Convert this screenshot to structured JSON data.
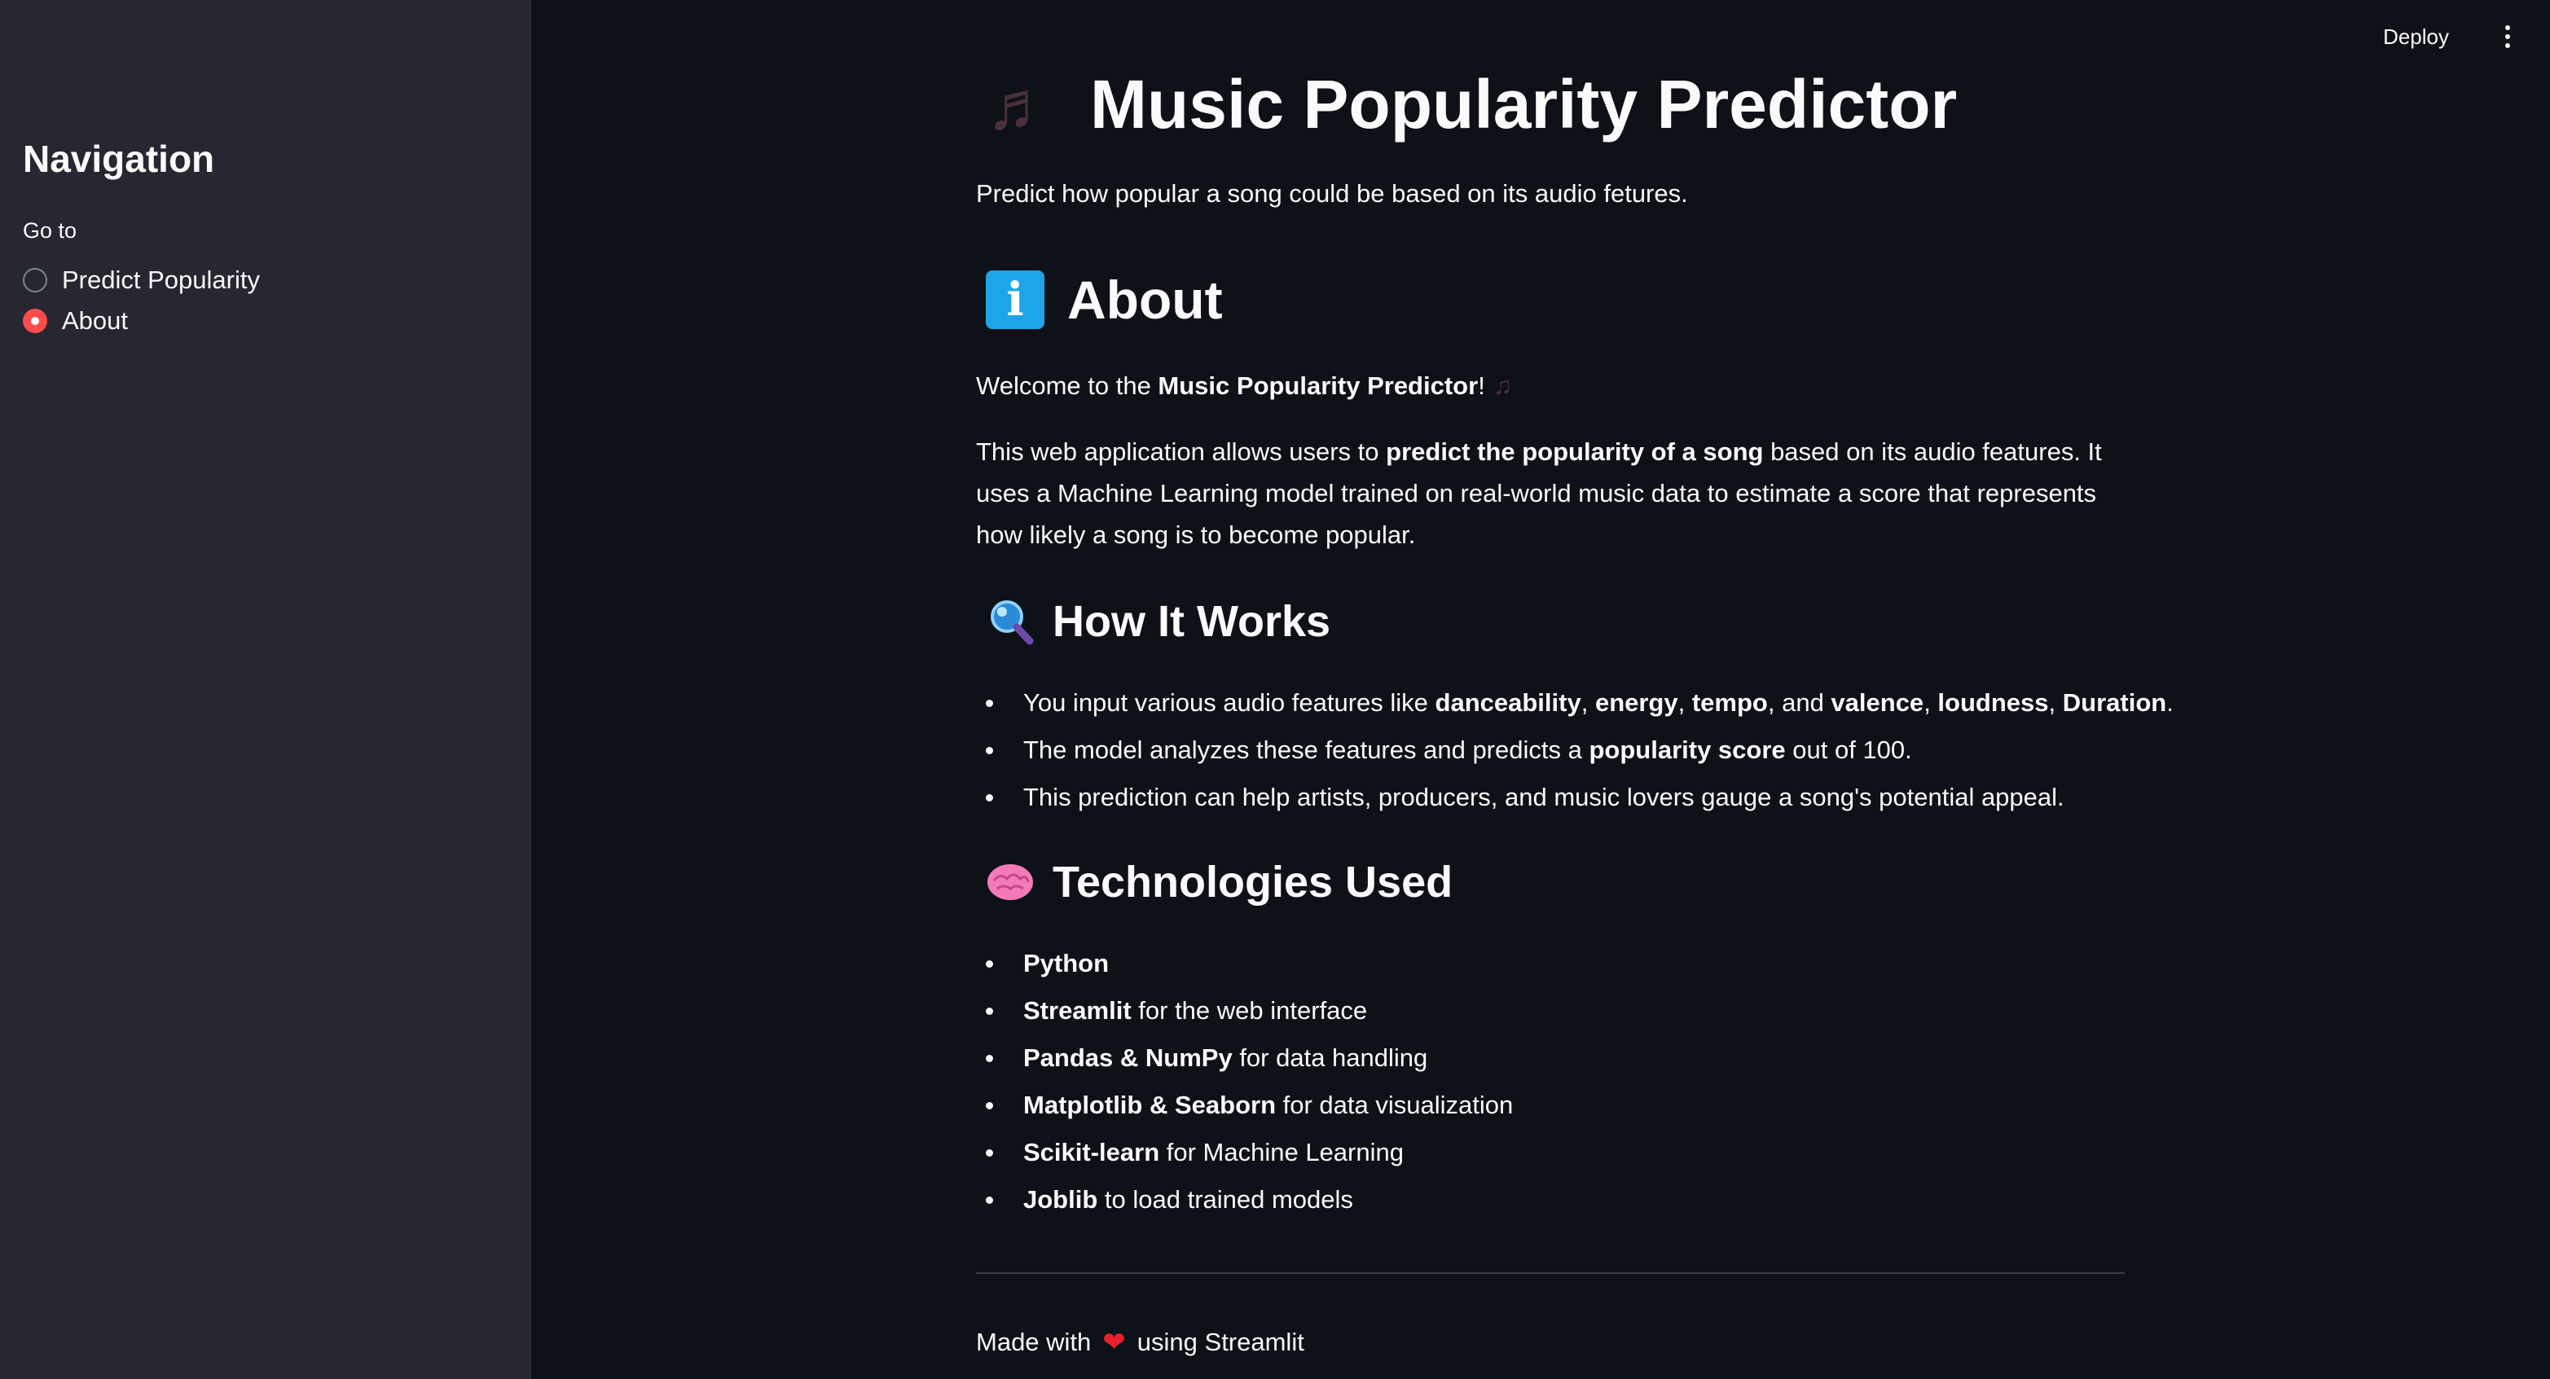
{
  "sidebar": {
    "title": "Navigation",
    "goto_label": "Go to",
    "options": [
      {
        "label": "Predict Popularity",
        "selected": false
      },
      {
        "label": "About",
        "selected": true
      }
    ]
  },
  "toolbar": {
    "deploy_label": "Deploy"
  },
  "main": {
    "title": "Music Popularity Predictor",
    "subtitle": "Predict how popular a song could be based on its audio fetures.",
    "about_heading": "About",
    "welcome_prefix": "Welcome to the ",
    "welcome_bold": "Music Popularity Predictor",
    "welcome_suffix": "!",
    "para_1": "This web application allows users to ",
    "para_bold": "predict the popularity of a song",
    "para_2": " based on its audio features. It uses a Machine Learning model trained on real-world music data to estimate a score that represents how likely a song is to become popular.",
    "how_heading": "How It Works",
    "how_items": {
      "item1": {
        "t1": "You input various audio features like ",
        "b1": "danceability",
        "t2": ", ",
        "b2": "energy",
        "t3": ", ",
        "b3": "tempo",
        "t4": ", and ",
        "b4": "valence",
        "t5": ", ",
        "b5": "loudness",
        "t6": ", ",
        "b6": "Duration",
        "t7": "."
      },
      "item2": {
        "t1": "The model analyzes these features and predicts a ",
        "b1": "popularity score",
        "t2": " out of 100."
      },
      "item3": {
        "t1": "This prediction can help artists, producers, and music lovers gauge a song's potential appeal."
      }
    },
    "tech_heading": "Technologies Used",
    "tech_items": [
      {
        "bold": "Python",
        "rest": ""
      },
      {
        "bold": "Streamlit",
        "rest": " for the web interface"
      },
      {
        "bold": "Pandas & NumPy",
        "rest": " for data handling"
      },
      {
        "bold": "Matplotlib & Seaborn",
        "rest": " for data visualization"
      },
      {
        "bold": "Scikit-learn",
        "rest": " for Machine Learning"
      },
      {
        "bold": "Joblib",
        "rest": " to load trained models"
      }
    ],
    "footer_prefix": "Made with",
    "footer_suffix": "using Streamlit"
  },
  "icons": {
    "title_icon": "musical-notes-icon",
    "about_icon": "info-icon",
    "how_icon": "magnifying-glass-icon",
    "tech_icon": "brain-icon",
    "footer_icon": "heart-icon"
  },
  "colors": {
    "background": "#0e1117",
    "sidebar": "#262730",
    "accent_red": "#ff4b4b",
    "info_blue": "#1ea5e8",
    "heart": "#e8202e"
  }
}
